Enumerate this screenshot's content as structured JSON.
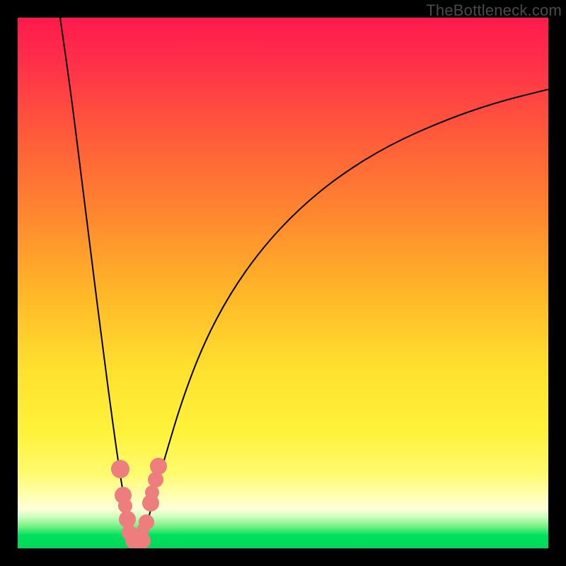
{
  "watermark": "TheBottleneck.com",
  "chart_data": {
    "type": "line",
    "title": "",
    "xlabel": "",
    "ylabel": "",
    "xlim": [
      0,
      100
    ],
    "ylim": [
      0,
      100
    ],
    "grid": false,
    "series": [
      {
        "name": "curve",
        "points": [
          {
            "x": 8.0,
            "y": 100.0
          },
          {
            "x": 10.0,
            "y": 86.0
          },
          {
            "x": 12.0,
            "y": 70.0
          },
          {
            "x": 14.0,
            "y": 54.0
          },
          {
            "x": 16.0,
            "y": 38.0
          },
          {
            "x": 18.0,
            "y": 23.0
          },
          {
            "x": 19.5,
            "y": 12.5
          },
          {
            "x": 21.0,
            "y": 4.0
          },
          {
            "x": 22.5,
            "y": 0.0
          },
          {
            "x": 24.0,
            "y": 3.0
          },
          {
            "x": 26.0,
            "y": 11.0
          },
          {
            "x": 28.0,
            "y": 18.0
          },
          {
            "x": 31.0,
            "y": 28.0
          },
          {
            "x": 35.0,
            "y": 38.5
          },
          {
            "x": 40.0,
            "y": 48.0
          },
          {
            "x": 46.0,
            "y": 56.5
          },
          {
            "x": 53.0,
            "y": 64.0
          },
          {
            "x": 61.0,
            "y": 70.5
          },
          {
            "x": 70.0,
            "y": 76.0
          },
          {
            "x": 80.0,
            "y": 80.5
          },
          {
            "x": 90.0,
            "y": 84.0
          },
          {
            "x": 100.0,
            "y": 86.5
          }
        ]
      }
    ],
    "markers": [
      {
        "x": 19.3,
        "y": 15.0,
        "r": 13
      },
      {
        "x": 19.8,
        "y": 10.0,
        "r": 12
      },
      {
        "x": 20.2,
        "y": 8.0,
        "r": 10
      },
      {
        "x": 20.7,
        "y": 5.5,
        "r": 12
      },
      {
        "x": 21.0,
        "y": 3.0,
        "r": 11
      },
      {
        "x": 21.8,
        "y": 1.5,
        "r": 12
      },
      {
        "x": 22.6,
        "y": 0.5,
        "r": 12
      },
      {
        "x": 23.4,
        "y": 1.5,
        "r": 12
      },
      {
        "x": 23.6,
        "y": 3.5,
        "r": 9
      },
      {
        "x": 24.2,
        "y": 5.0,
        "r": 11
      },
      {
        "x": 25.0,
        "y": 8.5,
        "r": 12
      },
      {
        "x": 25.3,
        "y": 10.5,
        "r": 10
      },
      {
        "x": 26.0,
        "y": 13.0,
        "r": 11
      },
      {
        "x": 26.5,
        "y": 15.5,
        "r": 12
      }
    ],
    "gradient_stops": [
      {
        "pos": 0.0,
        "color": "#ff1a4d"
      },
      {
        "pos": 0.22,
        "color": "#ff5a3a"
      },
      {
        "pos": 0.52,
        "color": "#ffb728"
      },
      {
        "pos": 0.78,
        "color": "#fff23a"
      },
      {
        "pos": 0.93,
        "color": "#ffffd0"
      },
      {
        "pos": 0.97,
        "color": "#40e070"
      },
      {
        "pos": 1.0,
        "color": "#00d858"
      }
    ]
  }
}
